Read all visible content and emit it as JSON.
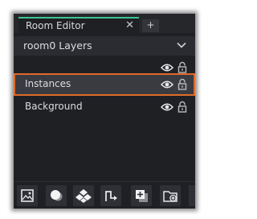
{
  "tab": {
    "label": "Room Editor",
    "close_glyph": "✕",
    "add_glyph": "+"
  },
  "layers": {
    "title": "room0 Layers",
    "rows": [
      {
        "label": "",
        "visibility_icon": "eye-icon",
        "lock_icon": "lock-icon"
      },
      {
        "label": "Instances",
        "selected": true,
        "visibility_icon": "eye-icon",
        "lock_icon": "lock-icon"
      },
      {
        "label": "Background",
        "visibility_icon": "eye-icon",
        "lock_icon": "lock-icon"
      }
    ]
  },
  "toolbar": {
    "buttons": [
      "background-layer-icon",
      "instance-layer-icon",
      "tile-layer-icon",
      "path-layer-icon",
      "asset-layer-icon",
      "folder-add-icon"
    ]
  },
  "colors": {
    "panel_bg": "#1f2024",
    "tab_accent": "#3ec48f",
    "selection_border": "#e06a2a",
    "text": "#dcdde0"
  }
}
